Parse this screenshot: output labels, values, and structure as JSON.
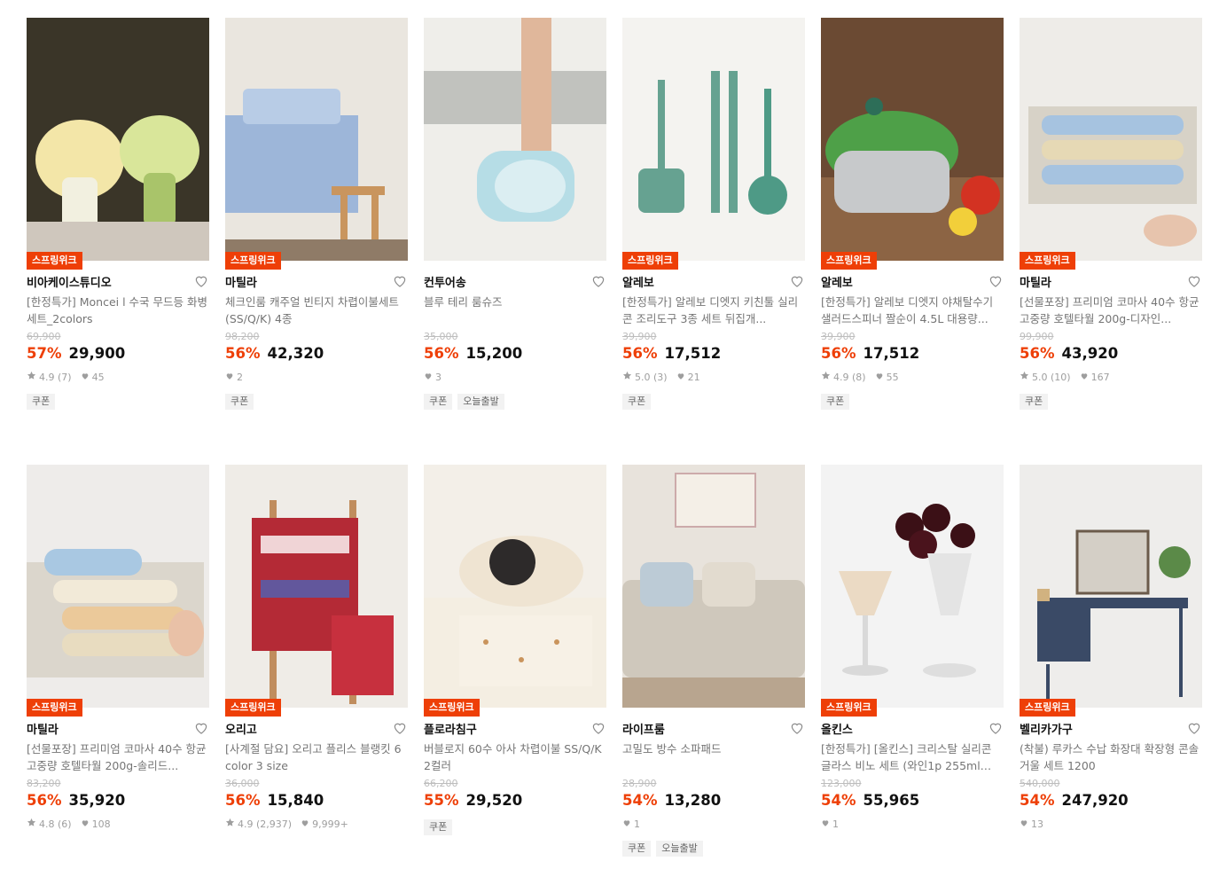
{
  "tag_label": "스프링위크",
  "accent_color": "#ee3f07",
  "products": [
    {
      "brand": "비아케이스튜디오",
      "title": "[한정특가] Moncei l 수국 무드등 화병 세트_2colors",
      "orig": "69,900",
      "pct": "57%",
      "price": "29,900",
      "rating": "4.9 (7)",
      "likes": "45",
      "badges": [
        "쿠폰"
      ],
      "tag": true
    },
    {
      "brand": "마틸라",
      "title": "체크인룸 캐주얼 빈티지 차렵이불세트 (SS/Q/K) 4종",
      "orig": "98,200",
      "pct": "56%",
      "price": "42,320",
      "rating": "",
      "likes": "2",
      "badges": [
        "쿠폰"
      ],
      "tag": true
    },
    {
      "brand": "컨투어송",
      "title": "블루 테리 룸슈즈",
      "orig": "35,000",
      "pct": "56%",
      "price": "15,200",
      "rating": "",
      "likes": "3",
      "badges": [
        "쿠폰",
        "오늘출발"
      ],
      "tag": false
    },
    {
      "brand": "알레보",
      "title": "[한정특가] 알레보 디엣지 키친툴 실리콘 조리도구 3종 세트 뒤집개...",
      "orig": "39,900",
      "pct": "56%",
      "price": "17,512",
      "rating": "5.0 (3)",
      "likes": "21",
      "badges": [
        "쿠폰"
      ],
      "tag": true
    },
    {
      "brand": "알레보",
      "title": "[한정특가] 알레보 디엣지 야채탈수기 샐러드스피너 짤순이 4.5L 대용량...",
      "orig": "39,900",
      "pct": "56%",
      "price": "17,512",
      "rating": "4.9 (8)",
      "likes": "55",
      "badges": [
        "쿠폰"
      ],
      "tag": true
    },
    {
      "brand": "마틸라",
      "title": "[선물포장] 프리미엄 코마사 40수 항균 고중량 호텔타월 200g-디자인...",
      "orig": "99,900",
      "pct": "56%",
      "price": "43,920",
      "rating": "5.0 (10)",
      "likes": "167",
      "badges": [
        "쿠폰"
      ],
      "tag": true
    },
    {
      "brand": "마틸라",
      "title": "[선물포장] 프리미엄 코마사 40수 항균 고중량 호텔타월 200g-솔리드...",
      "orig": "83,200",
      "pct": "56%",
      "price": "35,920",
      "rating": "4.8 (6)",
      "likes": "108",
      "badges": [],
      "tag": true
    },
    {
      "brand": "오리고",
      "title": "[사계절 담요] 오리고 플리스 블랭킷 6 color 3 size",
      "orig": "36,000",
      "pct": "56%",
      "price": "15,840",
      "rating": "4.9 (2,937)",
      "likes": "9,999+",
      "badges": [],
      "tag": true
    },
    {
      "brand": "플로라침구",
      "title": "버블로지 60수 아사 차렵이불 SS/Q/K 2컬러",
      "orig": "66,200",
      "pct": "55%",
      "price": "29,520",
      "rating": "",
      "likes": "",
      "badges": [
        "쿠폰"
      ],
      "tag": true
    },
    {
      "brand": "라이프룸",
      "title": "고밀도 방수 소파패드",
      "orig": "28,900",
      "pct": "54%",
      "price": "13,280",
      "rating": "",
      "likes": "1",
      "badges": [
        "쿠폰",
        "오늘출발"
      ],
      "tag": false
    },
    {
      "brand": "올킨스",
      "title": "[한정특가] [올킨스] 크리스탈 실리콘 글라스 비노 세트 (와인1p 255ml +...",
      "orig": "123,000",
      "pct": "54%",
      "price": "55,965",
      "rating": "",
      "likes": "1",
      "badges": [],
      "tag": true
    },
    {
      "brand": "벨리카가구",
      "title": "(착불) 루카스 수납 화장대 확장형 콘솔 거울 세트 1200",
      "orig": "540,000",
      "pct": "54%",
      "price": "247,920",
      "rating": "",
      "likes": "13",
      "badges": [],
      "tag": true
    }
  ]
}
